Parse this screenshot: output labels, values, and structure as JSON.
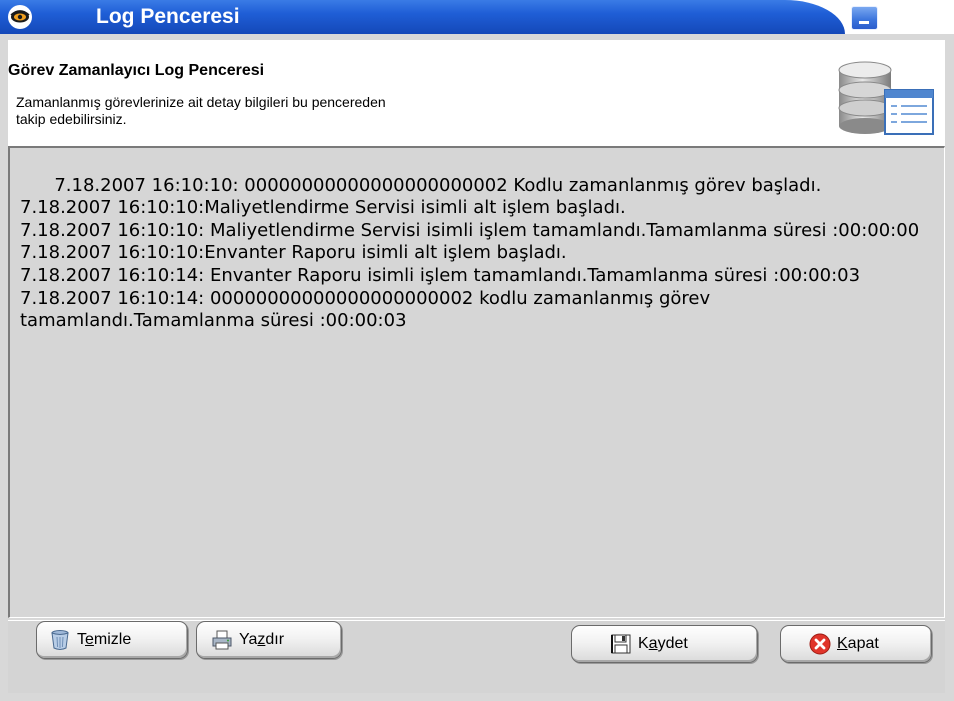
{
  "window": {
    "title": "Log Penceresi"
  },
  "header": {
    "title": "Görev Zamanlayıcı Log Penceresi",
    "description": "Zamanlanmış görevlerinize ait  detay bilgileri bu pencereden\ntakip edebilirsiniz."
  },
  "log": {
    "lines": [
      "7.18.2007 16:10:10: 00000000000000000000002 Kodlu zamanlanmış görev başladı.",
      "7.18.2007 16:10:10:Maliyetlendirme Servisi isimli alt işlem başladı.",
      "7.18.2007 16:10:10: Maliyetlendirme Servisi isimli işlem tamamlandı.Tamamlanma süresi :00:00:00",
      "7.18.2007 16:10:10:Envanter Raporu isimli alt işlem başladı.",
      "7.18.2007 16:10:14: Envanter Raporu isimli işlem tamamlandı.Tamamlanma süresi :00:00:03",
      "7.18.2007 16:10:14: 00000000000000000000002 kodlu zamanlanmış görev tamamlandı.Tamamlanma süresi :00:00:03"
    ]
  },
  "buttons": {
    "temizle": {
      "pre": "T",
      "accel": "e",
      "post": "mizle"
    },
    "yazdir": {
      "pre": "Ya",
      "accel": "z",
      "post": "dır"
    },
    "kaydet": {
      "pre": "K",
      "accel": "a",
      "post": "ydet"
    },
    "kapat": {
      "pre": "",
      "accel": "K",
      "post": "apat"
    }
  },
  "icons": {
    "app": "eye-icon",
    "minimize": "minimize-icon",
    "database": "database-list-icon",
    "temizle": "trash-bin-icon",
    "yazdir": "printer-icon",
    "kaydet": "save-disk-icon",
    "kapat": "close-x-icon"
  },
  "colors": {
    "titlebar": "#1f5ed6",
    "log_background": "#d6d6d6",
    "kapat_icon": "#e0352b"
  }
}
